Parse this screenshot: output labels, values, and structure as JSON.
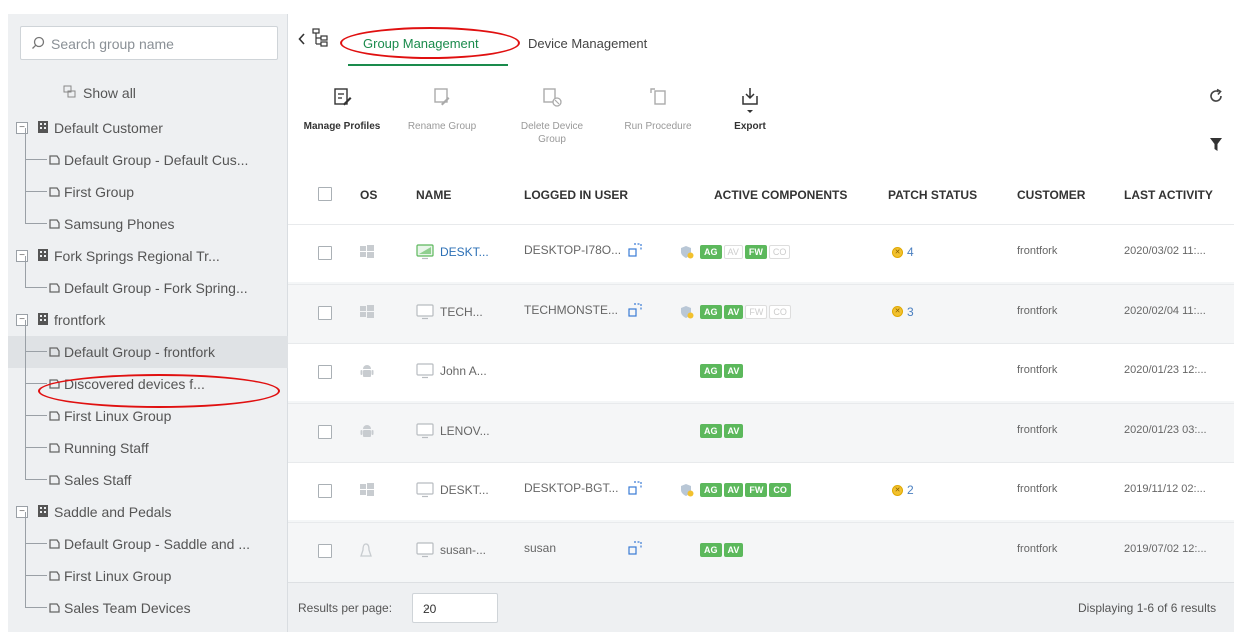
{
  "sidebar": {
    "search_placeholder": "Search group name",
    "show_all": "Show all",
    "tree": [
      {
        "type": "customer",
        "label": "Default Customer"
      },
      {
        "type": "group",
        "label": "Default Group - Default Cus..."
      },
      {
        "type": "group",
        "label": "First Group"
      },
      {
        "type": "group",
        "label": "Samsung Phones"
      },
      {
        "type": "customer",
        "label": "Fork Springs Regional Tr..."
      },
      {
        "type": "group",
        "label": "Default Group - Fork Spring..."
      },
      {
        "type": "customer",
        "label": "frontfork"
      },
      {
        "type": "group",
        "label": "Default Group - frontfork",
        "selected": true
      },
      {
        "type": "group",
        "label": "Discovered devices f..."
      },
      {
        "type": "group",
        "label": "First Linux Group"
      },
      {
        "type": "group",
        "label": "Running Staff"
      },
      {
        "type": "group",
        "label": "Sales Staff"
      },
      {
        "type": "customer",
        "label": "Saddle and Pedals"
      },
      {
        "type": "group",
        "label": "Default Group - Saddle and ..."
      },
      {
        "type": "group",
        "label": "First Linux Group"
      },
      {
        "type": "group",
        "label": "Sales Team Devices"
      }
    ]
  },
  "tabs": {
    "group_management": "Group Management",
    "device_management": "Device Management"
  },
  "toolbar": {
    "manage_profiles": "Manage Profiles",
    "rename_group": "Rename Group",
    "delete_device_group_1": "Delete Device",
    "delete_device_group_2": "Group",
    "run_procedure": "Run Procedure",
    "export": "Export"
  },
  "table": {
    "headers": {
      "os": "OS",
      "name": "NAME",
      "logged_in_user": "LOGGED IN USER",
      "active_components": "ACTIVE COMPONENTS",
      "patch_status": "PATCH STATUS",
      "customer": "CUSTOMER",
      "last_activity": "LAST ACTIVITY"
    },
    "rows": [
      {
        "os": "windows",
        "name": "DESKT...",
        "name_link": true,
        "user": "DESKTOP-I78O...",
        "remote": true,
        "shield": true,
        "components": [
          {
            "t": "AG",
            "on": true
          },
          {
            "t": "AV",
            "on": false
          },
          {
            "t": "FW",
            "on": true
          },
          {
            "t": "CO",
            "on": false
          }
        ],
        "patch": "4",
        "customer": "frontfork",
        "last": "2020/03/02 11:..."
      },
      {
        "os": "windows",
        "name": "TECH...",
        "name_link": false,
        "user": "TECHMONSTE...",
        "remote": true,
        "shield": true,
        "components": [
          {
            "t": "AG",
            "on": true
          },
          {
            "t": "AV",
            "on": true
          },
          {
            "t": "FW",
            "on": false
          },
          {
            "t": "CO",
            "on": false
          }
        ],
        "patch": "3",
        "customer": "frontfork",
        "last": "2020/02/04 11:..."
      },
      {
        "os": "android",
        "name": "John A...",
        "name_link": false,
        "user": "",
        "remote": false,
        "shield": false,
        "components": [
          {
            "t": "AG",
            "on": true
          },
          {
            "t": "AV",
            "on": true
          }
        ],
        "patch": "",
        "customer": "frontfork",
        "last": "2020/01/23 12:..."
      },
      {
        "os": "android",
        "name": "LENOV...",
        "name_link": false,
        "user": "",
        "remote": false,
        "shield": false,
        "components": [
          {
            "t": "AG",
            "on": true
          },
          {
            "t": "AV",
            "on": true
          }
        ],
        "patch": "",
        "customer": "frontfork",
        "last": "2020/01/23 03:..."
      },
      {
        "os": "windows",
        "name": "DESKT...",
        "name_link": false,
        "user": "DESKTOP-BGT...",
        "remote": true,
        "shield": true,
        "components": [
          {
            "t": "AG",
            "on": true
          },
          {
            "t": "AV",
            "on": true
          },
          {
            "t": "FW",
            "on": true
          },
          {
            "t": "CO",
            "on": true
          }
        ],
        "patch": "2",
        "customer": "frontfork",
        "last": "2019/11/12 02:..."
      },
      {
        "os": "linux",
        "name": "susan-...",
        "name_link": false,
        "user": "susan",
        "remote": true,
        "shield": false,
        "components": [
          {
            "t": "AG",
            "on": true
          },
          {
            "t": "AV",
            "on": true
          }
        ],
        "patch": "",
        "customer": "frontfork",
        "last": "2019/07/02 12:..."
      }
    ]
  },
  "footer": {
    "results_per_page": "Results per page:",
    "per_page_value": "20",
    "displaying": "Displaying 1-6 of 6 results"
  },
  "colors": {
    "accent_green": "#1a8b4c",
    "badge_green": "#5cb85c",
    "annotation_red": "#e01010"
  }
}
